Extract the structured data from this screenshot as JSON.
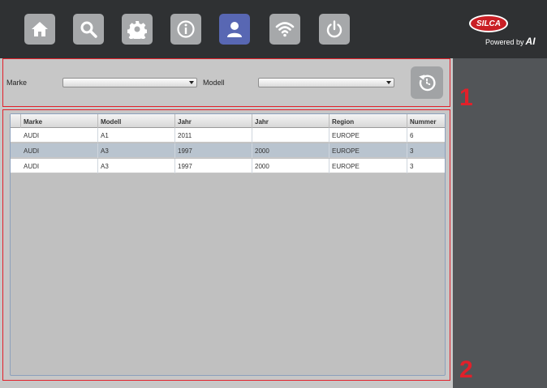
{
  "toolbar": {
    "buttons": [
      {
        "icon": "home-icon",
        "active": false
      },
      {
        "icon": "search-icon",
        "active": false
      },
      {
        "icon": "gear-icon",
        "active": false
      },
      {
        "icon": "info-icon",
        "active": false
      },
      {
        "icon": "user-icon",
        "active": true
      },
      {
        "icon": "wifi-icon",
        "active": false
      },
      {
        "icon": "power-icon",
        "active": false
      }
    ],
    "logo": {
      "brand": "SILCA",
      "powered_by": "Powered by",
      "partner": "AI"
    }
  },
  "filters": {
    "marke_label": "Marke",
    "marke_value": "",
    "modell_label": "Modell",
    "modell_value": ""
  },
  "callouts": {
    "one": "1",
    "two": "2"
  },
  "table": {
    "columns": [
      "Marke",
      "Modell",
      "Jahr",
      "Jahr",
      "Region",
      "Nummer"
    ],
    "rows": [
      [
        "AUDI",
        "A1",
        "2011",
        "",
        "EUROPE",
        "6"
      ],
      [
        "AUDI",
        "A3",
        "1997",
        "2000",
        "EUROPE",
        "3"
      ],
      [
        "AUDI",
        "A3",
        "1997",
        "2000",
        "EUROPE",
        "3"
      ]
    ]
  },
  "colors": {
    "accent_active": "#5867b3",
    "callout_red": "#e2202a",
    "toolbar_bg": "#2f3133"
  }
}
